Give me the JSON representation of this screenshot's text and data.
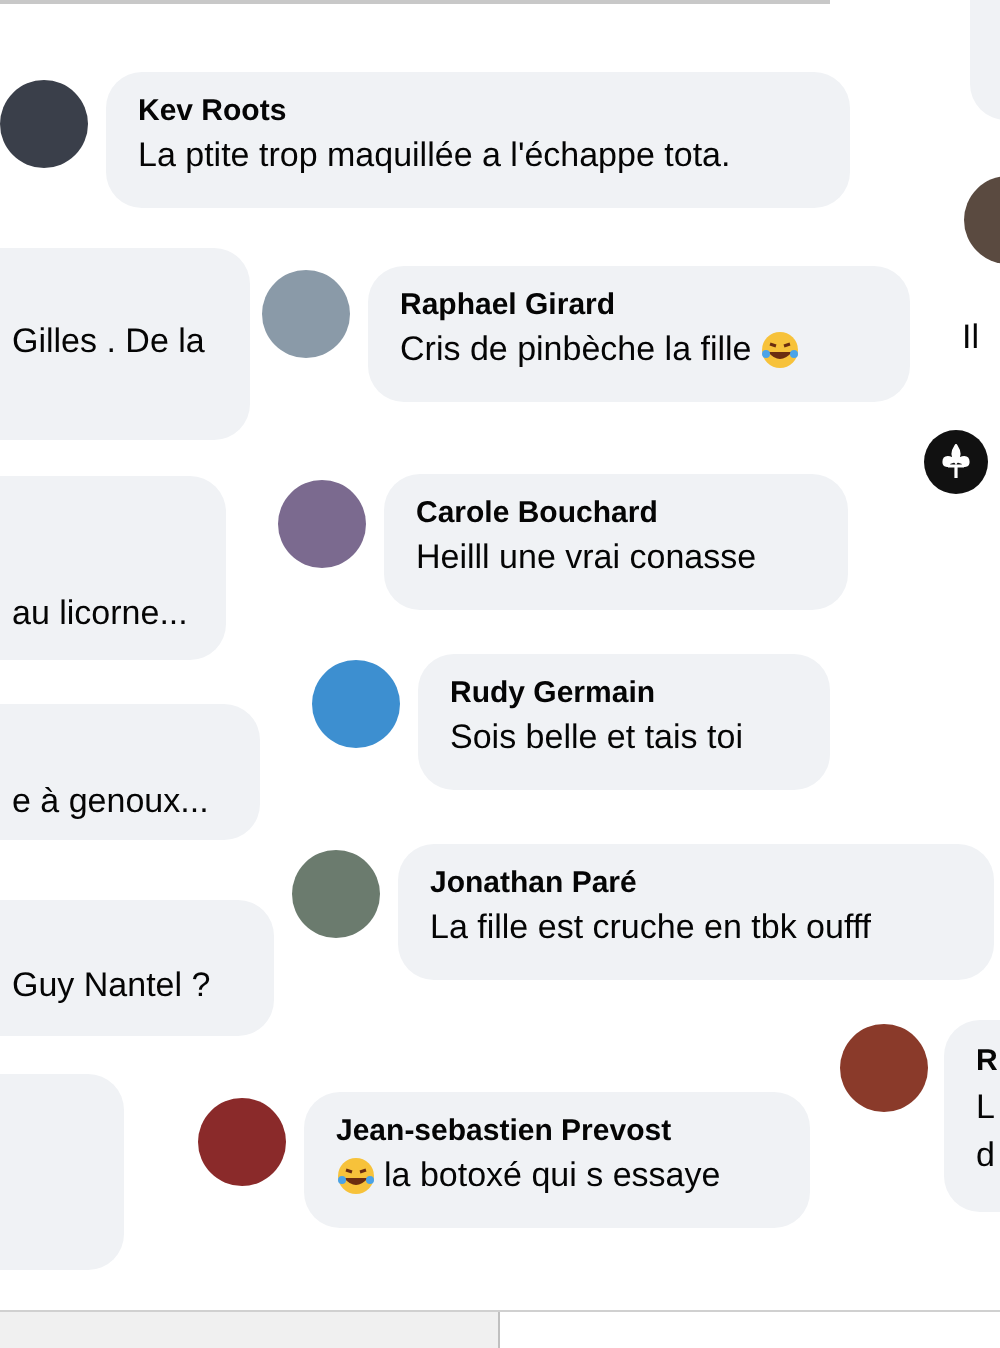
{
  "comments": [
    {
      "author": "Kev Roots",
      "text": "La ptite trop maquillée a l'échappe tota.",
      "kind": "plain"
    },
    {
      "author": "Raphael Girard",
      "text": "Cris de pinbèche la fille",
      "kind": "emoji_end"
    },
    {
      "author": "Carole Bouchard",
      "text": "Heilll une vrai conasse",
      "kind": "plain"
    },
    {
      "author": "Rudy Germain",
      "text": "Sois belle et tais toi",
      "kind": "plain"
    },
    {
      "author": "Jonathan Paré",
      "text": "La fille est cruche en tbk oufff",
      "kind": "plain"
    },
    {
      "author": "Jean-sebastien Prevost",
      "text": "la botoxé qui s essaye",
      "kind": "emoji_start"
    }
  ],
  "left_fragments": [
    {
      "text": "Gilles . De la"
    },
    {
      "text": "au licorne..."
    },
    {
      "text": "e à genoux..."
    },
    {
      "text": "Guy Nantel ?"
    }
  ],
  "right_fragments": [
    {
      "text": "Il"
    }
  ],
  "right_bubble": {
    "lines": [
      "R",
      "L",
      "d"
    ]
  }
}
